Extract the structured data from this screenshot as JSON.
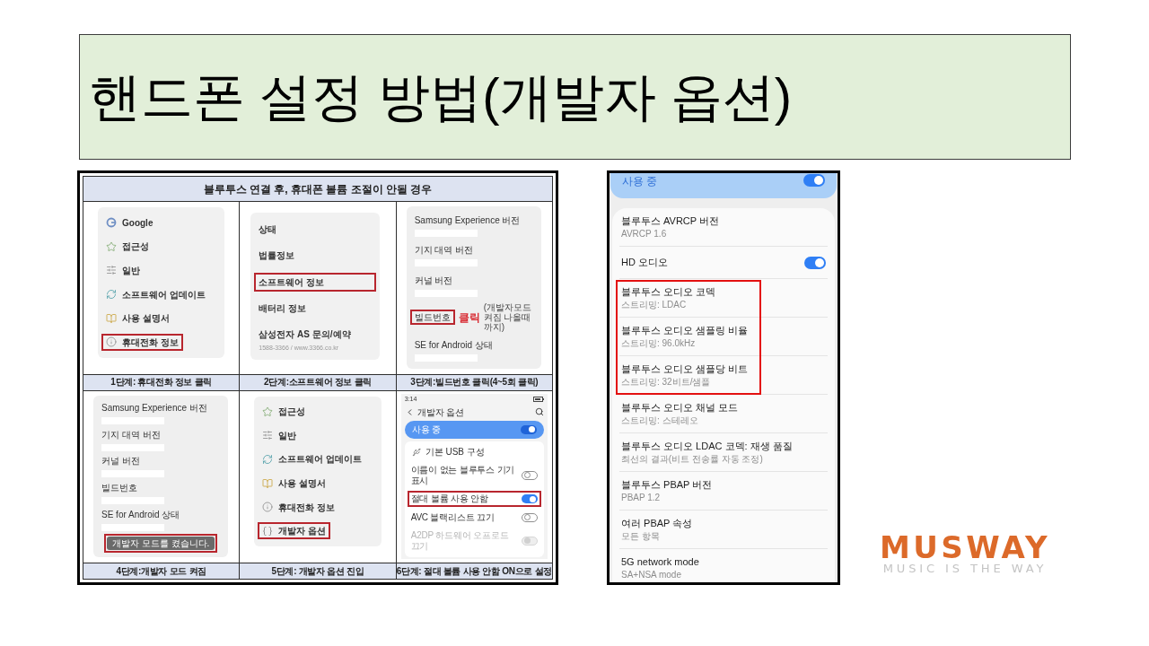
{
  "title": "핸드폰 설정 방법(개발자 옵션)",
  "guide": {
    "heading": "블루투스 연결 후, 휴대폰 볼륨 조절이 안될 경우",
    "steps": [
      {
        "kind": "menu",
        "caption": "1단계: 휴대전화 정보 클릭",
        "items": [
          {
            "label": "Google",
            "highlighted": false
          },
          {
            "label": "접근성",
            "highlighted": false
          },
          {
            "label": "일반",
            "highlighted": false
          },
          {
            "label": "소프트웨어 업데이트",
            "highlighted": false
          },
          {
            "label": "사용 설명서",
            "highlighted": false
          },
          {
            "label": "휴대전화 정보",
            "highlighted": true
          }
        ]
      },
      {
        "kind": "info",
        "caption": "2단계:소프트웨어 정보 클릭",
        "items": [
          {
            "label": "상태",
            "highlighted": false
          },
          {
            "label": "법률정보",
            "highlighted": false
          },
          {
            "label": "소프트웨어 정보",
            "highlighted": true
          },
          {
            "label": "배터리 정보",
            "highlighted": false
          },
          {
            "label": "삼성전자 AS 문의/예약",
            "highlighted": false,
            "detail": "1588-3366 / www.3366.co.kr"
          }
        ]
      },
      {
        "kind": "versions",
        "caption": "3단계:빌드번호 클릭(4~5회 클릭)",
        "items": [
          {
            "label": "Samsung Experience 버전",
            "highlighted": false
          },
          {
            "label": "기지 대역 버전",
            "highlighted": false
          },
          {
            "label": "커널 버전",
            "highlighted": false
          },
          {
            "label": "빌드번호",
            "highlighted": true,
            "note": "클릭",
            "note_detail": "(개발자모드 켜짐 나올때까지)"
          },
          {
            "label": "SE for Android 상태",
            "highlighted": false
          }
        ]
      },
      {
        "kind": "versions",
        "caption": "4단계:개발자 모드 켜짐",
        "items": [
          {
            "label": "Samsung Experience 버전",
            "highlighted": false
          },
          {
            "label": "기지 대역 버전",
            "highlighted": false
          },
          {
            "label": "커널 버전",
            "highlighted": false
          },
          {
            "label": "빌드번호",
            "highlighted": false
          },
          {
            "label": "SE for Android 상태",
            "highlighted": false
          }
        ],
        "toast": {
          "text": "개발자 모드를 켰습니다.",
          "highlighted": true
        }
      },
      {
        "kind": "menu",
        "caption": "5단계: 개발자 옵션 진입",
        "items": [
          {
            "label": "접근성",
            "highlighted": false
          },
          {
            "label": "일반",
            "highlighted": false
          },
          {
            "label": "소프트웨어 업데이트",
            "highlighted": false
          },
          {
            "label": "사용 설명서",
            "highlighted": false
          },
          {
            "label": "휴대전화 정보",
            "highlighted": false
          },
          {
            "label": "개발자 옵션",
            "highlighted": true
          }
        ]
      },
      {
        "kind": "developer",
        "caption": "6단계: 절대 볼륨 사용 안함 ON으로 설정",
        "status_time": "3:14",
        "title": "개발자 옵션",
        "master": {
          "label": "사용 중",
          "on": true
        },
        "items": [
          {
            "kind": "link",
            "label": "기본 USB 구성",
            "highlighted": false
          },
          {
            "kind": "toggle",
            "label": "이름이 없는 블루투스 기기 표시",
            "on": false,
            "disabled": false,
            "highlighted": false
          },
          {
            "kind": "toggle",
            "label": "절대 볼륨 사용 안함",
            "on": true,
            "disabled": false,
            "highlighted": true
          },
          {
            "kind": "toggle",
            "label": "AVC 블랙리스트 끄기",
            "on": false,
            "disabled": false,
            "highlighted": false
          },
          {
            "kind": "toggle",
            "label": "A2DP 하드웨어 오프로드 끄기",
            "on": false,
            "disabled": true,
            "highlighted": false
          }
        ]
      }
    ]
  },
  "phone": {
    "master": {
      "label": "사용 중",
      "on": true
    },
    "items": [
      {
        "kind": "info",
        "title": "블루투스 AVRCP 버전",
        "summary": "AVRCP 1.6",
        "highlighted": false
      },
      {
        "kind": "toggle",
        "title": "HD 오디오",
        "on": true,
        "highlighted": false
      },
      {
        "kind": "info",
        "title": "블루투스 오디오 코덱",
        "summary": "스트리밍: LDAC",
        "highlighted": true
      },
      {
        "kind": "info",
        "title": "블루투스 오디오 샘플링 비율",
        "summary": "스트리밍: 96.0kHz",
        "highlighted": true
      },
      {
        "kind": "info",
        "title": "블루투스 오디오 샘플당 비트",
        "summary": "스트리밍: 32비트/샘플",
        "highlighted": true
      },
      {
        "kind": "info",
        "title": "블루투스 오디오 채널 모드",
        "summary": "스트리밍: 스테레오",
        "highlighted": false
      },
      {
        "kind": "info",
        "title": "블루투스 오디오 LDAC 코덱: 재생 품질",
        "summary": "최선의 결과(비트 전송률 자동 조정)",
        "highlighted": false
      },
      {
        "kind": "info",
        "title": "블루투스 PBAP 버전",
        "summary": "PBAP 1.2",
        "highlighted": false
      },
      {
        "kind": "info",
        "title": "여러 PBAP 속성",
        "summary": "모든 항목",
        "highlighted": false
      },
      {
        "kind": "info",
        "title": "5G network mode",
        "summary": "SA+NSA mode",
        "highlighted": false
      }
    ]
  },
  "logo": {
    "wordmark": "MUSWAY",
    "tagline": "MUSIC IS THE WAY"
  }
}
